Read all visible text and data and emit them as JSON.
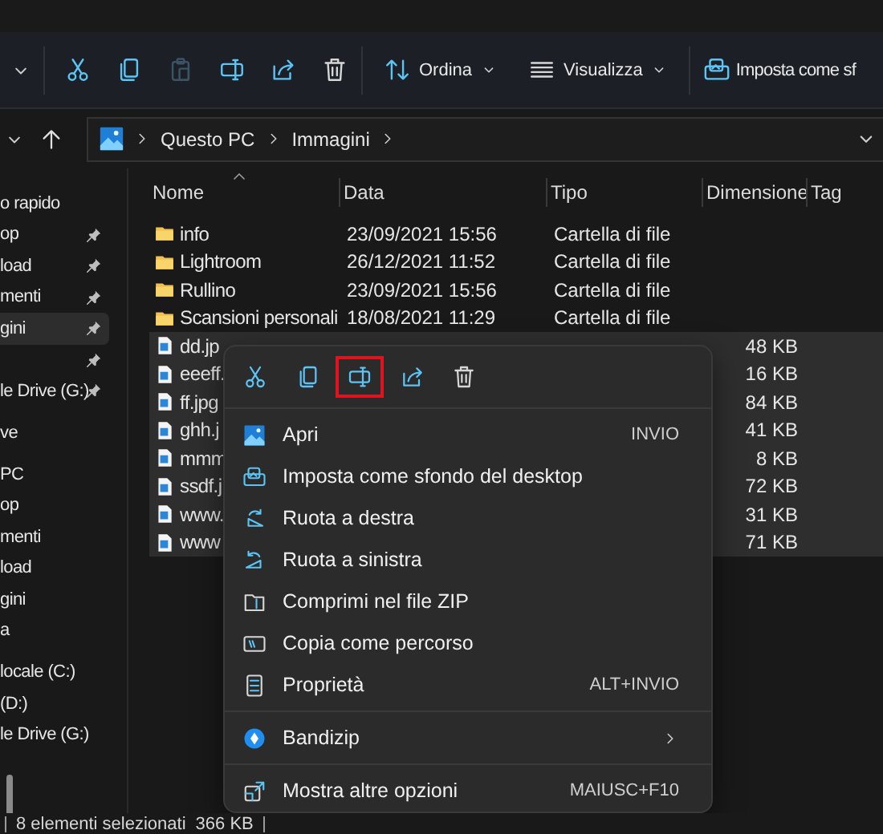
{
  "toolbar": {
    "groups": [
      [
        {
          "kind": "caret",
          "disabled": false,
          "dropdown": true
        }
      ],
      [
        {
          "kind": "cut",
          "disabled": false,
          "dropdown": false
        },
        {
          "kind": "copy",
          "disabled": false,
          "dropdown": false
        },
        {
          "kind": "paste",
          "disabled": true,
          "dropdown": false
        },
        {
          "kind": "rename",
          "disabled": false,
          "dropdown": false
        },
        {
          "kind": "share",
          "disabled": false,
          "dropdown": false
        },
        {
          "kind": "delete",
          "disabled": false,
          "dropdown": false
        }
      ],
      [
        {
          "kind": "sort",
          "label": "Ordina",
          "disabled": false,
          "dropdown": true
        },
        {
          "kind": "view",
          "label": "Visualizza",
          "disabled": false,
          "dropdown": true
        }
      ],
      [
        {
          "kind": "wallpaper",
          "label": "Imposta come sf",
          "disabled": false,
          "dropdown": false
        }
      ]
    ]
  },
  "address": {
    "crumbs": [
      "Questo PC",
      "Immagini"
    ]
  },
  "sidebar": {
    "sections": [
      {
        "items": [
          {
            "label": "o rapido",
            "pinned": false,
            "selected": false
          },
          {
            "label": "op",
            "pinned": true,
            "selected": false
          },
          {
            "label": "load",
            "pinned": true,
            "selected": false
          },
          {
            "label": "menti",
            "pinned": true,
            "selected": false
          },
          {
            "label": "gini",
            "pinned": true,
            "selected": true
          },
          {
            "pinned": true,
            "selected": false
          },
          {
            "label": "le Drive (G:)",
            "pinned": true,
            "selected": false
          }
        ]
      },
      {
        "items": [
          {
            "label": "ve",
            "pinned": false,
            "selected": false
          }
        ]
      },
      {
        "items": [
          {
            "label": "PC",
            "pinned": false,
            "selected": false
          },
          {
            "label": "op",
            "pinned": false,
            "selected": false
          },
          {
            "label": "menti",
            "pinned": false,
            "selected": false
          },
          {
            "label": "load",
            "pinned": false,
            "selected": false
          },
          {
            "label": "gini",
            "pinned": false,
            "selected": false
          },
          {
            "label": "a",
            "pinned": false,
            "selected": false
          }
        ]
      },
      {
        "items": [
          {
            "label": "locale (C:)",
            "pinned": false,
            "selected": false
          },
          {
            "label": "(D:)",
            "pinned": false,
            "selected": false
          },
          {
            "label": "le Drive (G:)",
            "pinned": false,
            "selected": false
          }
        ]
      }
    ]
  },
  "files": {
    "columns": [
      {
        "label": "Nome",
        "sorted": true
      },
      {
        "label": "Data",
        "sorted": false
      },
      {
        "label": "Tipo",
        "sorted": false
      },
      {
        "label": "Dimensione",
        "sorted": false
      },
      {
        "label": "Tag",
        "sorted": false
      }
    ],
    "rows": [
      {
        "kind": "folder",
        "name": "info",
        "date": "23/09/2021 15:56",
        "type": "Cartella di file",
        "selected": false
      },
      {
        "kind": "folder",
        "name": "Lightroom",
        "date": "26/12/2021 11:52",
        "type": "Cartella di file",
        "selected": false
      },
      {
        "kind": "folder",
        "name": "Rullino",
        "date": "23/09/2021 15:56",
        "type": "Cartella di file",
        "selected": false
      },
      {
        "kind": "folder",
        "name": "Scansioni personali",
        "date": "18/08/2021 11:29",
        "type": "Cartella di file",
        "selected": false
      },
      {
        "kind": "image",
        "name": "dd.jp",
        "size": "48 KB",
        "selected": true
      },
      {
        "kind": "image",
        "name": "eeeff.",
        "size": "16 KB",
        "selected": true
      },
      {
        "kind": "image",
        "name": "ff.jpg",
        "size": "84 KB",
        "selected": true
      },
      {
        "kind": "image",
        "name": "ghh.j",
        "size": "41 KB",
        "selected": true
      },
      {
        "kind": "image",
        "name": "mmm",
        "size": "8 KB",
        "selected": true
      },
      {
        "kind": "image",
        "name": "ssdf.j",
        "size": "72 KB",
        "selected": true
      },
      {
        "kind": "image",
        "name": "www.",
        "size": "31 KB",
        "selected": true
      },
      {
        "kind": "image",
        "name": "www",
        "size": "71 KB",
        "selected": true
      }
    ]
  },
  "context_menu": {
    "actions": [
      {
        "kind": "cut",
        "highlighted": false
      },
      {
        "kind": "copy",
        "highlighted": false
      },
      {
        "kind": "rename",
        "highlighted": true
      },
      {
        "kind": "share",
        "highlighted": false
      },
      {
        "kind": "delete",
        "highlighted": false
      }
    ],
    "sections": [
      [
        {
          "kind": "open",
          "label": "Apri",
          "shortcut": "INVIO",
          "submenu": false
        },
        {
          "kind": "wallpaper",
          "label": "Imposta come sfondo del desktop",
          "submenu": false
        },
        {
          "kind": "rotate-right",
          "label": "Ruota a destra",
          "submenu": false
        },
        {
          "kind": "rotate-left",
          "label": "Ruota a sinistra",
          "submenu": false
        },
        {
          "kind": "zip",
          "label": "Comprimi nel file ZIP",
          "submenu": false
        },
        {
          "kind": "path",
          "label": "Copia come percorso",
          "submenu": false
        },
        {
          "kind": "properties",
          "label": "Proprietà",
          "shortcut": "ALT+INVIO",
          "submenu": false
        }
      ],
      [
        {
          "kind": "bandizip",
          "label": "Bandizip",
          "submenu": true
        }
      ],
      [
        {
          "kind": "more",
          "label": "Mostra altre opzioni",
          "shortcut": "MAIUSC+F10",
          "submenu": false
        }
      ]
    ]
  },
  "status_bar": {
    "selection": "8 elementi selezionati",
    "size": "366 KB"
  }
}
